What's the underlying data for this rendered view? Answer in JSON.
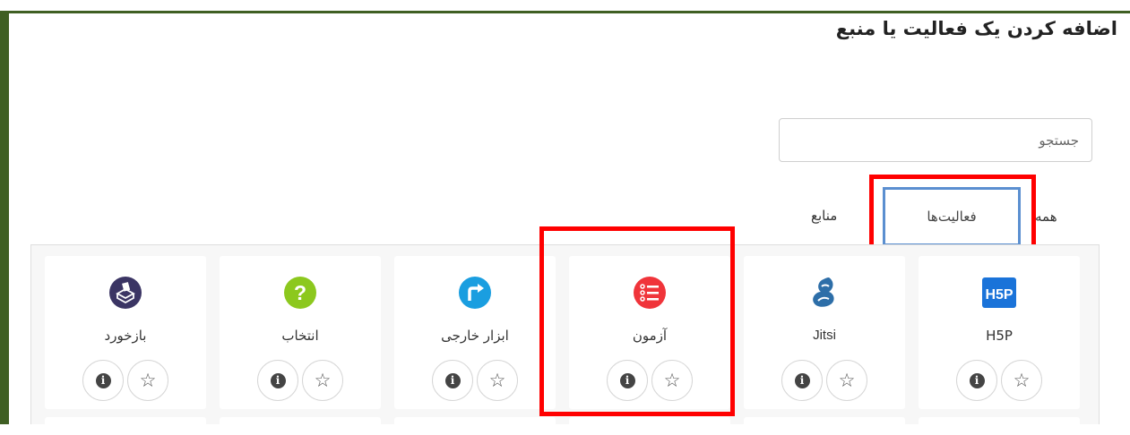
{
  "dialog": {
    "title": "اضافه کردن یک فعالیت یا منبع"
  },
  "search": {
    "placeholder": "جستجو"
  },
  "tabs": {
    "all": "همه",
    "activities": "فعالیت‌ها",
    "resources": "منابع"
  },
  "modules": [
    {
      "label": "H5P",
      "icon": "h5p-icon",
      "color": "#1a73d9"
    },
    {
      "label": "Jitsi",
      "icon": "jitsi-icon",
      "color": "#2d6ea8"
    },
    {
      "label": "آزمون",
      "icon": "quiz-icon",
      "color": "#f0343a"
    },
    {
      "label": "ابزار خارجی",
      "icon": "external-tool-icon",
      "color": "#1a9ee0"
    },
    {
      "label": "انتخاب",
      "icon": "choice-icon",
      "color": "#8cc81e"
    },
    {
      "label": "بازخورد",
      "icon": "feedback-icon",
      "color": "#3b3564"
    }
  ],
  "buttons": {
    "info_icon": "info-icon",
    "star_icon": "star-icon"
  },
  "colors": {
    "frame_border": "#3f5f23",
    "highlight": "#ff0000",
    "active_tab": "#5b8fd0"
  }
}
